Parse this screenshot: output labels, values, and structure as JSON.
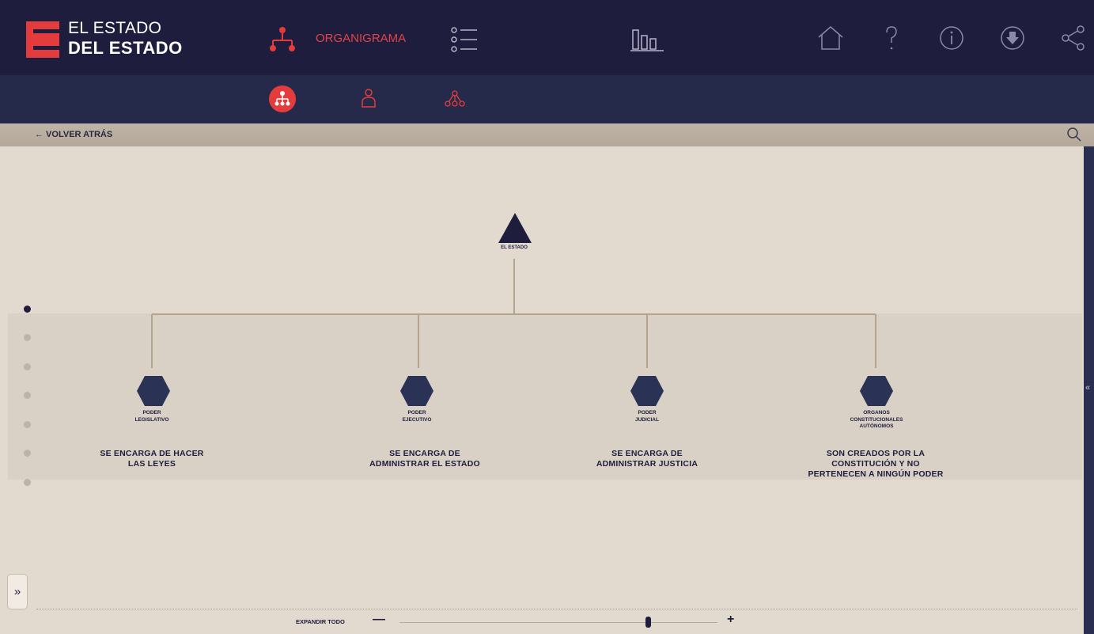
{
  "brand": {
    "line1": "EL ESTADO",
    "line2": "DEL ESTADO"
  },
  "nav": {
    "organigrama_label": "ORGANIGRAMA"
  },
  "back": {
    "label": "← VOLVER ATRÁS"
  },
  "tree": {
    "root": {
      "title": "EL ESTADO"
    },
    "children": [
      {
        "title_line1": "PODER",
        "title_line2": "LEGISLATIVO",
        "title_line3": "",
        "desc_line1": "SE ENCARGA DE HACER",
        "desc_line2": "LAS LEYES",
        "desc_line3": ""
      },
      {
        "title_line1": "PODER",
        "title_line2": "EJECUTIVO",
        "title_line3": "",
        "desc_line1": "SE ENCARGA DE",
        "desc_line2": "ADMINISTRAR EL ESTADO",
        "desc_line3": ""
      },
      {
        "title_line1": "PODER",
        "title_line2": "JUDICIAL",
        "title_line3": "",
        "desc_line1": "SE ENCARGA DE",
        "desc_line2": "ADMINISTRAR JUSTICIA",
        "desc_line3": ""
      },
      {
        "title_line1": "ORGANOS",
        "title_line2": "CONSTITUCIONALES",
        "title_line3": "AUTÓNOMOS",
        "desc_line1": "SON CREADOS POR LA",
        "desc_line2": "CONSTITUCIÓN Y NO",
        "desc_line3": "PERTENECEN A NINGÚN PODER"
      }
    ]
  },
  "levels": {
    "count": 7,
    "active": 1
  },
  "footer": {
    "expand_label": "EXPANDIR TODO",
    "minus": "—",
    "plus": "+",
    "expand_glyph": "»",
    "collapse_glyph": "«"
  },
  "zoom": {
    "value": 0.78
  },
  "colors": {
    "navy": "#1f1d3d",
    "accent": "#e43c3c",
    "beige": "#e2d9cf",
    "line": "#b4a48e"
  },
  "icons": [
    "org-chart-icon",
    "list-icon",
    "bar-chart-icon",
    "home-icon",
    "help-icon",
    "info-icon",
    "download-icon",
    "share-icon",
    "person-icon",
    "network-icon",
    "search-icon"
  ]
}
